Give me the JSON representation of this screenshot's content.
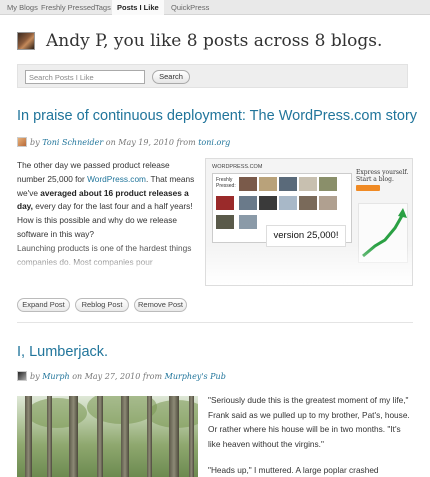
{
  "nav": {
    "tabs": [
      {
        "label": "My Blogs"
      },
      {
        "label": "Freshly Pressed"
      },
      {
        "label": "Tags"
      },
      {
        "label": "Posts I Like"
      },
      {
        "label": "QuickPress"
      }
    ]
  },
  "header": {
    "title": "Andy P, you like 8 posts across 8 blogs."
  },
  "search": {
    "placeholder": "Search Posts I Like",
    "button_label": "Search"
  },
  "posts": [
    {
      "title": "In praise of continuous deployment: The WordPress.com story",
      "author": "Toni Schneider",
      "date_prefix": "on May 19, 2010 from",
      "blog": "toni.org",
      "by": "by",
      "para1_part1": "The other day we passed product release number 25,000 for ",
      "para1_link": "WordPress.com",
      "para1_part2": ". That means we've ",
      "para1_bold": "averaged about 16 product releases  a day,",
      "para1_part3": " every day for the last four and a half years! How is this possible and why do we release software in this way?",
      "para2": "Launching products is one of the hardest things companies do. Most companies pour",
      "thumbnail": {
        "site_label": "WORDPRESS.COM",
        "freshly_pressed": "Freshly Pressed:",
        "express_text": "Express yourself. Start a blog.",
        "version_text": "version 25,000!"
      },
      "actions": {
        "expand": "Expand Post",
        "reblog": "Reblog Post",
        "remove": "Remove Post"
      }
    },
    {
      "title": "I, Lumberjack.",
      "by": "by",
      "author": "Murph",
      "date_prefix": "on May 27, 2010 from",
      "blog": "Murphey's Pub",
      "quote1": "\"Seriously dude this is the greatest moment of my life,\" Frank said as we pulled up to my brother, Pat's, house. Or rather where his house will be in two months.  \"It's like heaven without the virgins.\"",
      "quote2": "\"Heads up,\" I muttered.  A large poplar crashed"
    }
  ],
  "colors": {
    "link": "#21759b",
    "nav_bg": "#e9e9e9",
    "search_bg": "#eeeeee"
  }
}
